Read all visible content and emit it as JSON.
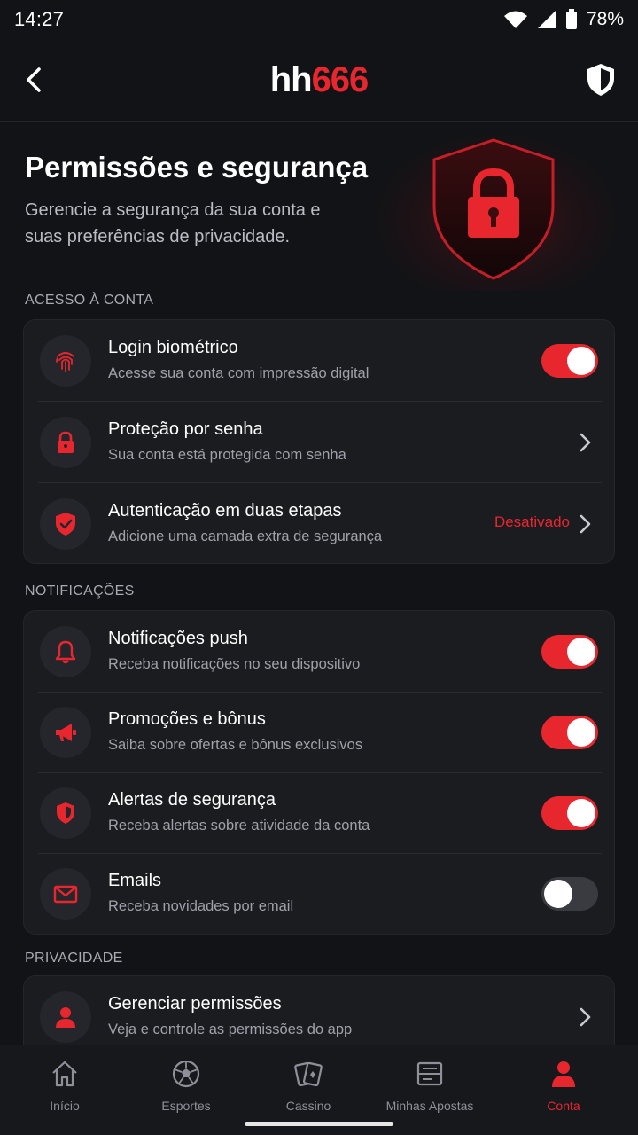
{
  "status_bar": {
    "time": "14:27",
    "battery": "78%"
  },
  "header": {
    "logo_part1": "hh",
    "logo_part2": "666"
  },
  "hero": {
    "title": "Permissões e segurança",
    "subtitle": "Gerencie a segurança da sua conta e suas preferências de privacidade."
  },
  "sections": {
    "account": {
      "label": "ACESSO À CONTA",
      "rows": [
        {
          "title": "Login biométrico",
          "desc": "Acesse sua conta com impressão digital",
          "icon": "fingerprint-icon",
          "toggle": true
        },
        {
          "title": "Proteção por senha",
          "desc": "Sua conta está protegida com senha",
          "icon": "lock-icon"
        },
        {
          "title": "Autenticação em duas etapas",
          "desc": "Adicione uma camada extra de segurança",
          "icon": "shield-check-icon",
          "status": "Desativado"
        }
      ]
    },
    "notifications": {
      "label": "NOTIFICAÇÕES",
      "rows": [
        {
          "title": "Notificações push",
          "desc": "Receba notificações no seu dispositivo",
          "icon": "bell-icon",
          "toggle": true
        },
        {
          "title": "Promoções e bônus",
          "desc": "Saiba sobre ofertas e bônus exclusivos",
          "icon": "megaphone-icon",
          "toggle": true
        },
        {
          "title": "Alertas de segurança",
          "desc": "Receba alertas sobre atividade da conta",
          "icon": "shield-alert-icon",
          "toggle": true
        },
        {
          "title": "Emails",
          "desc": "Receba novidades por email",
          "icon": "mail-icon",
          "toggle": false
        }
      ]
    },
    "privacy": {
      "label": "PRIVACIDADE",
      "rows": [
        {
          "title": "Gerenciar permissões",
          "desc": "Veja e controle as permissões do app",
          "icon": "user-icon"
        }
      ]
    }
  },
  "bottom_nav": {
    "items": [
      {
        "label": "Início",
        "icon": "home-icon"
      },
      {
        "label": "Esportes",
        "icon": "soccer-ball-icon"
      },
      {
        "label": "Cassino",
        "icon": "cards-icon"
      },
      {
        "label": "Minhas Apostas",
        "icon": "ticket-icon"
      },
      {
        "label": "Conta",
        "icon": "user-icon",
        "active": true
      }
    ]
  },
  "colors": {
    "accent": "#e8262e",
    "background": "#121316",
    "card": "#1b1c20"
  }
}
